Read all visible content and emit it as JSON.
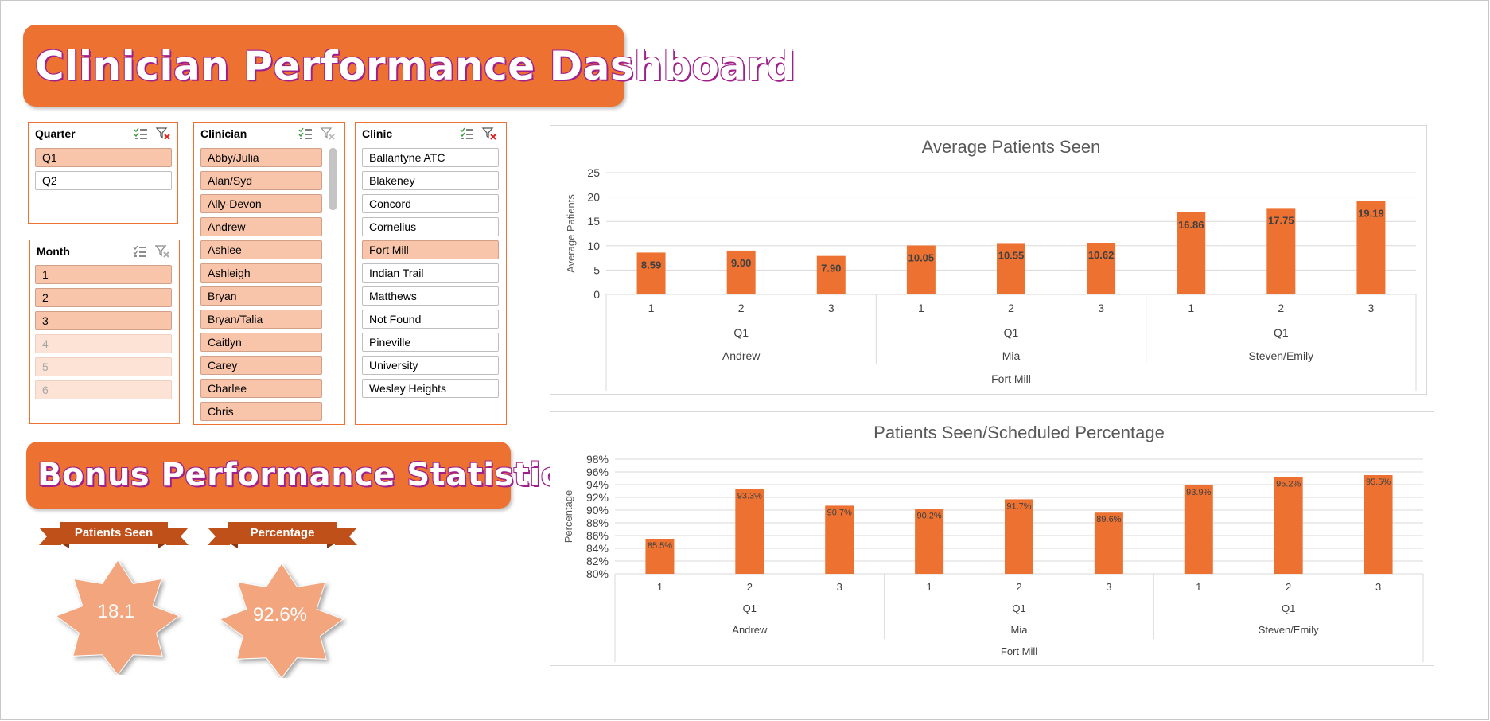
{
  "dashboard": {
    "title": "Clinician Performance Dashboard"
  },
  "bonus": {
    "title": "Bonus Performance Statistics",
    "patients_seen_label": "Patients Seen",
    "patients_seen_value": "18.1",
    "percentage_label": "Percentage",
    "percentage_value": "92.6%"
  },
  "colors": {
    "accent": "#ed7232",
    "selected": "#f8c5aa",
    "star": "#f3a57e",
    "ribbon": "#c0501a"
  },
  "slicers": {
    "quarter": {
      "title": "Quarter",
      "items": [
        {
          "label": "Q1",
          "state": "selected"
        },
        {
          "label": "Q2",
          "state": "normal"
        }
      ]
    },
    "month": {
      "title": "Month",
      "items": [
        {
          "label": "1",
          "state": "selected"
        },
        {
          "label": "2",
          "state": "selected"
        },
        {
          "label": "3",
          "state": "selected"
        },
        {
          "label": "4",
          "state": "nodata"
        },
        {
          "label": "5",
          "state": "nodata"
        },
        {
          "label": "6",
          "state": "nodata"
        }
      ]
    },
    "clinician": {
      "title": "Clinician",
      "items": [
        {
          "label": "Abby/Julia",
          "state": "selected"
        },
        {
          "label": "Alan/Syd",
          "state": "selected"
        },
        {
          "label": "Ally-Devon",
          "state": "selected"
        },
        {
          "label": "Andrew",
          "state": "selected"
        },
        {
          "label": "Ashlee",
          "state": "selected"
        },
        {
          "label": "Ashleigh",
          "state": "selected"
        },
        {
          "label": "Bryan",
          "state": "selected"
        },
        {
          "label": "Bryan/Talia",
          "state": "selected"
        },
        {
          "label": "Caitlyn",
          "state": "selected"
        },
        {
          "label": "Carey",
          "state": "selected"
        },
        {
          "label": "Charlee",
          "state": "selected"
        },
        {
          "label": "Chris",
          "state": "selected"
        }
      ]
    },
    "clinic": {
      "title": "Clinic",
      "items": [
        {
          "label": "Ballantyne ATC",
          "state": "normal"
        },
        {
          "label": "Blakeney",
          "state": "normal"
        },
        {
          "label": "Concord",
          "state": "normal"
        },
        {
          "label": "Cornelius",
          "state": "normal"
        },
        {
          "label": "Fort Mill",
          "state": "selected"
        },
        {
          "label": "Indian Trail",
          "state": "normal"
        },
        {
          "label": "Matthews",
          "state": "normal"
        },
        {
          "label": "Not Found",
          "state": "normal"
        },
        {
          "label": "Pineville",
          "state": "normal"
        },
        {
          "label": "University",
          "state": "normal"
        },
        {
          "label": "Wesley Heights",
          "state": "normal"
        }
      ]
    }
  },
  "chart_data": [
    {
      "type": "bar",
      "title": "Average Patients Seen",
      "ylabel": "Average Patients",
      "xlabel": "",
      "ylim": [
        0,
        25
      ],
      "yticks": [
        "0",
        "5",
        "10",
        "15",
        "20",
        "25"
      ],
      "grid": true,
      "categories": [
        "1",
        "2",
        "3",
        "1",
        "2",
        "3",
        "1",
        "2",
        "3"
      ],
      "quarter_groups": [
        "Q1",
        "Q1",
        "Q1"
      ],
      "clinician_groups": [
        "Andrew",
        "Mia",
        "Steven/Emily"
      ],
      "clinic_group": "Fort Mill",
      "values": [
        8.59,
        9.0,
        7.9,
        10.05,
        10.55,
        10.62,
        16.86,
        17.75,
        19.19
      ],
      "data_labels": [
        "8.59",
        "9.00",
        "7.90",
        "10.05",
        "10.55",
        "10.62",
        "16.86",
        "17.75",
        "19.19"
      ]
    },
    {
      "type": "bar",
      "title": "Patients Seen/Scheduled Percentage",
      "ylabel": "Percentage",
      "xlabel": "",
      "ylim": [
        0.8,
        0.98
      ],
      "yticks": [
        "80%",
        "82%",
        "84%",
        "86%",
        "88%",
        "90%",
        "92%",
        "94%",
        "96%",
        "98%"
      ],
      "grid": true,
      "categories": [
        "1",
        "2",
        "3",
        "1",
        "2",
        "3",
        "1",
        "2",
        "3"
      ],
      "quarter_groups": [
        "Q1",
        "Q1",
        "Q1"
      ],
      "clinician_groups": [
        "Andrew",
        "Mia",
        "Steven/Emily"
      ],
      "clinic_group": "Fort Mill",
      "values": [
        0.855,
        0.933,
        0.907,
        0.902,
        0.917,
        0.896,
        0.939,
        0.952,
        0.955
      ],
      "data_labels": [
        "85.5%",
        "93.3%",
        "90.7%",
        "90.2%",
        "91.7%",
        "89.6%",
        "93.9%",
        "95.2%",
        "95.5%"
      ]
    }
  ]
}
